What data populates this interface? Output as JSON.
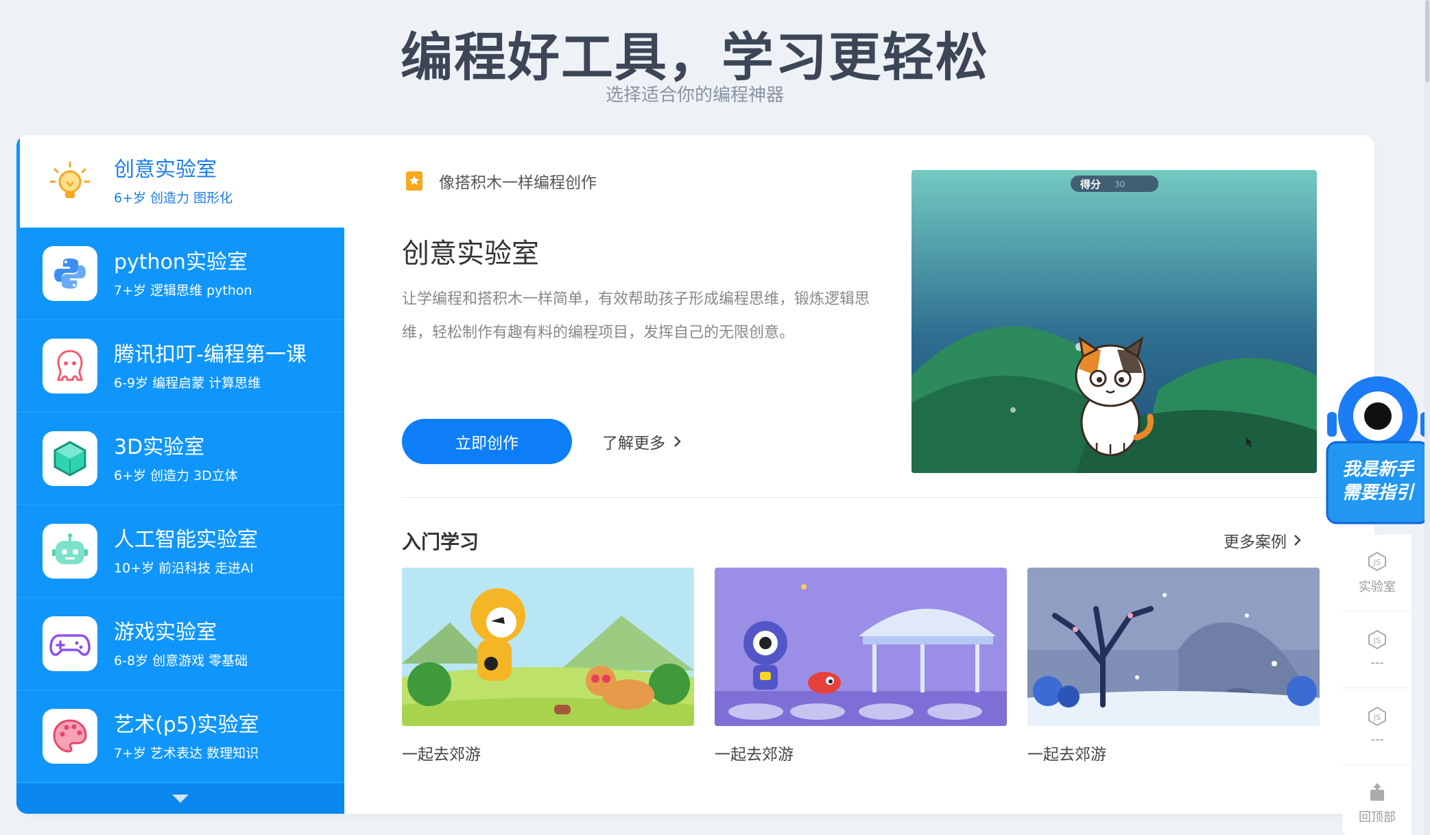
{
  "header": {
    "title": "编程好工具，学习更轻松",
    "subtitle": "选择适合你的编程神器"
  },
  "sidebar": {
    "items": [
      {
        "title": "创意实验室",
        "desc": "6+岁 创造力 图形化",
        "icon": "lightbulb-icon",
        "active": true
      },
      {
        "title": "python实验室",
        "desc": "7+岁 逻辑思维 python",
        "icon": "python-icon"
      },
      {
        "title": "腾讯扣叮-编程第一课",
        "desc": "6-9岁 编程启蒙 计算思维",
        "icon": "octopus-icon"
      },
      {
        "title": "3D实验室",
        "desc": "6+岁 创造力 3D立体",
        "icon": "cube-icon"
      },
      {
        "title": "人工智能实验室",
        "desc": "10+岁 前沿科技 走进AI",
        "icon": "robot-icon"
      },
      {
        "title": "游戏实验室",
        "desc": "6-8岁 创意游戏 零基础",
        "icon": "gamepad-icon"
      },
      {
        "title": "艺术(p5)实验室",
        "desc": "7+岁 艺术表达 数理知识",
        "icon": "palette-icon"
      }
    ]
  },
  "main": {
    "tag": "像搭积木一样编程创作",
    "title": "创意实验室",
    "description": "让学编程和搭积木一样简单，有效帮助孩子形成编程思维，锻炼逻辑思维，轻松制作有趣有料的编程项目，发挥自己的无限创意。",
    "cta_label": "立即创作",
    "learn_more_label": "了解更多",
    "hero": {
      "score_label": "得分",
      "score_value": "30"
    }
  },
  "section": {
    "title": "入门学习",
    "more_label": "更多案例",
    "cases": [
      {
        "label": "一起去郊游"
      },
      {
        "label": "一起去郊游"
      },
      {
        "label": "一起去郊游"
      }
    ]
  },
  "floating": {
    "guide_line1": "我是新手",
    "guide_line2": "需要指引",
    "items": [
      {
        "label": "实验室"
      },
      {
        "label": "---"
      },
      {
        "label": "---"
      },
      {
        "label": "回顶部"
      }
    ]
  },
  "colors": {
    "brand": "#1096fb",
    "cta": "#0d7ef7",
    "page_bg": "#eef2f7"
  }
}
